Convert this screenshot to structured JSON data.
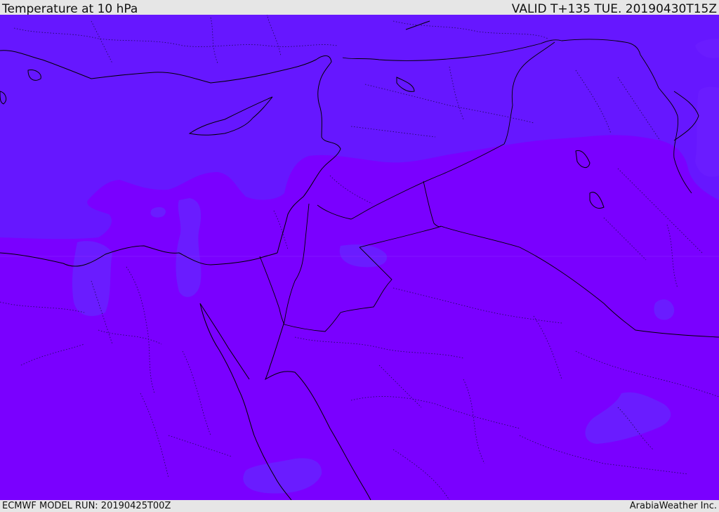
{
  "header": {
    "title": "Temperature at 10 hPa",
    "valid": "VALID T+135 TUE. 20190430T15Z"
  },
  "footer": {
    "model_run": "ECMWF MODEL RUN: 20190425T00Z",
    "credit": "ArabiaWeather Inc."
  },
  "colors": {
    "field_warm": "#7a00ff",
    "field_cool": "#6515ff",
    "coastline": "#000000",
    "borders": "#1a0a55"
  }
}
